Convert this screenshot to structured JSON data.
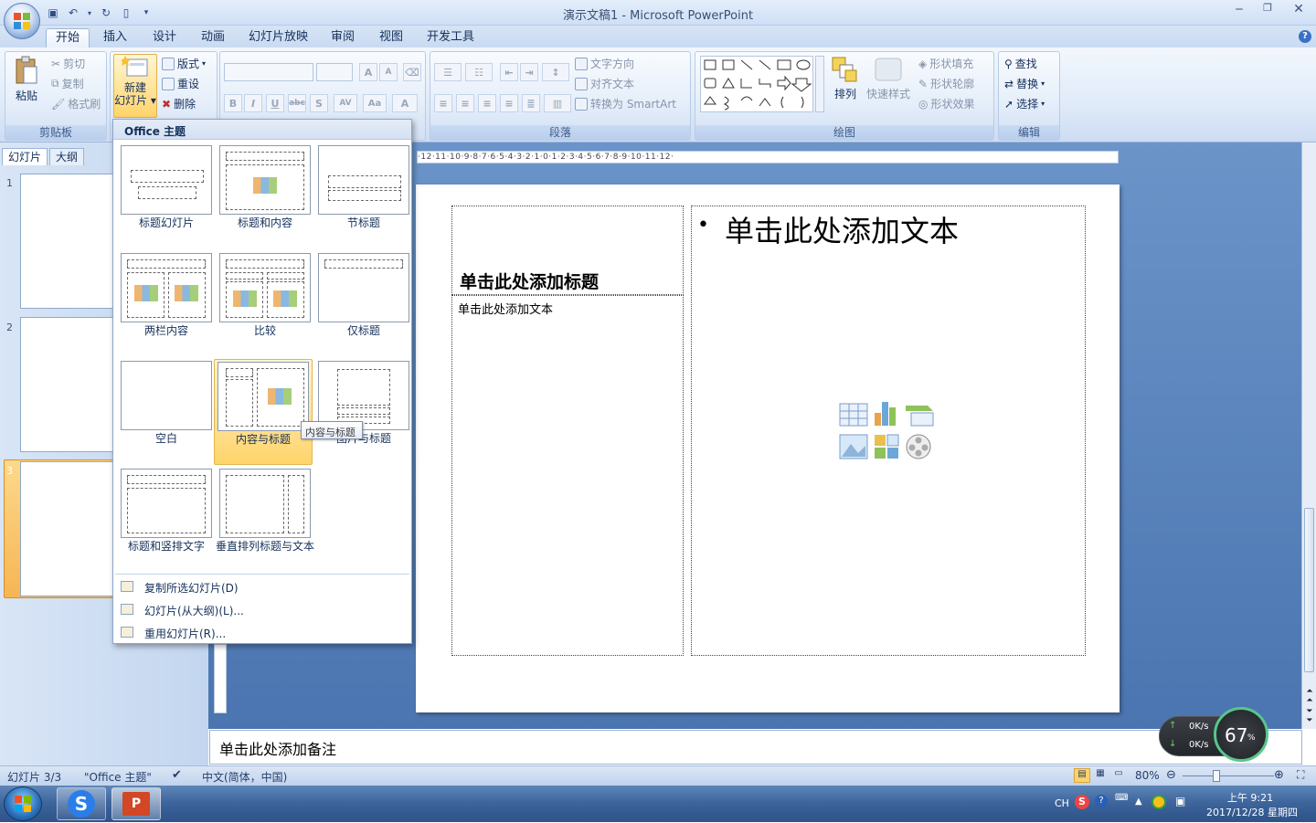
{
  "window": {
    "title": "演示文稿1 - Microsoft PowerPoint"
  },
  "tabs": [
    "开始",
    "插入",
    "设计",
    "动画",
    "幻灯片放映",
    "审阅",
    "视图",
    "开发工具"
  ],
  "ribbon": {
    "clipboard": {
      "paste": "粘贴",
      "cut": "剪切",
      "copy": "复制",
      "format_painter": "格式刷",
      "label": "剪贴板"
    },
    "slides": {
      "new_slide_line1": "新建",
      "new_slide_line2": "幻灯片",
      "layout": "版式",
      "reset": "重设",
      "delete": "删除"
    },
    "font": {
      "bold": "B",
      "italic": "I",
      "underline": "U",
      "strike": "abc",
      "shadow": "S",
      "spacing": "AV",
      "case": "Aa",
      "grow": "A",
      "shrink": "A"
    },
    "paragraph": {
      "text_direction": "文字方向",
      "align_text": "对齐文本",
      "smartart": "转换为 SmartArt",
      "label": "段落"
    },
    "drawing": {
      "arrange": "排列",
      "quick_styles": "快速样式",
      "shape_fill": "形状填充",
      "shape_outline": "形状轮廓",
      "shape_effects": "形状效果",
      "label": "绘图"
    },
    "editing": {
      "find": "查找",
      "replace": "替换",
      "select": "选择",
      "label": "编辑"
    }
  },
  "left_pane": {
    "tab_slides": "幻灯片",
    "tab_outline": "大纲",
    "slide_numbers": [
      "1",
      "2",
      "3"
    ]
  },
  "ruler": {
    "text": "·12·11·10·9·8·7·6·5·4·3·2·1·0·1·2·3·4·5·6·7·8·9·10·11·12·"
  },
  "gallery": {
    "header": "Office 主题",
    "layouts": [
      "标题幻灯片",
      "标题和内容",
      "节标题",
      "两栏内容",
      "比较",
      "仅标题",
      "空白",
      "内容与标题",
      "图片与标题",
      "标题和竖排文字",
      "垂直排列标题与文本"
    ],
    "tooltip": "内容与标题",
    "menu": [
      "复制所选幻灯片(D)",
      "幻灯片(从大纲)(L)...",
      "重用幻灯片(R)..."
    ]
  },
  "slide": {
    "title_placeholder": "单击此处添加标题",
    "body_placeholder": "单击此处添加文本",
    "content_placeholder": "单击此处添加文本",
    "bullet": "•"
  },
  "notes": {
    "placeholder": "单击此处添加备注"
  },
  "status": {
    "slide_count": "幻灯片 3/3",
    "theme": "\"Office 主题\"",
    "language": "中文(简体，中国)",
    "zoom": "80%"
  },
  "net_widget": {
    "up": "0K/s",
    "down": "0K/s",
    "percent": "67",
    "percent_sign": "%"
  },
  "tray": {
    "lang": "CH",
    "time": "上午 9:21",
    "date": "2017/12/28 星期四"
  },
  "colors": {
    "accent_blue": "#4b75b0",
    "selected_orange": "#f7b553"
  }
}
